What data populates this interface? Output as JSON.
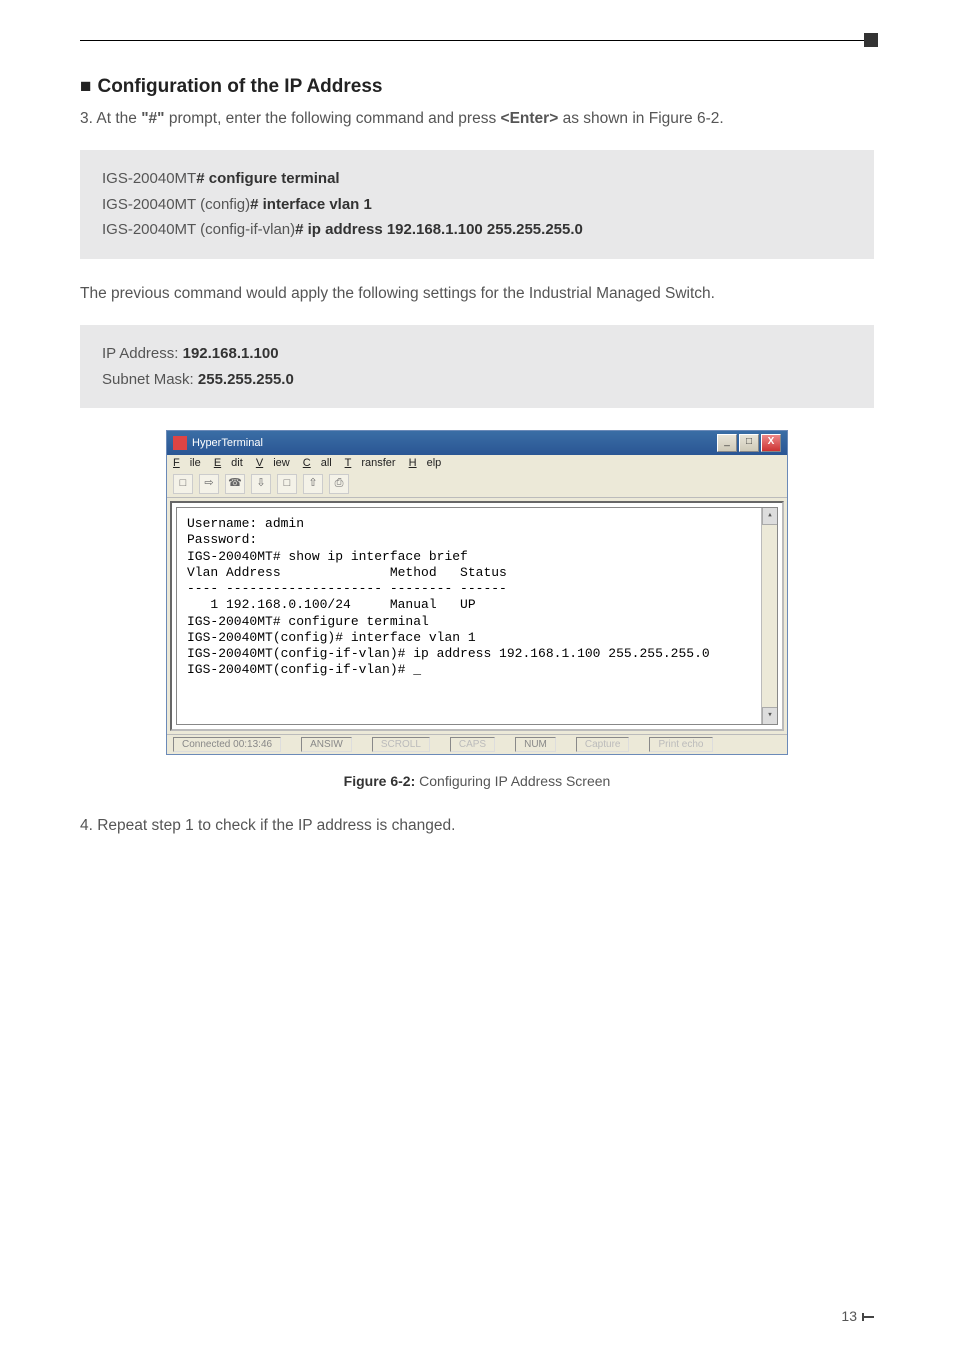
{
  "section": {
    "bullet": "■",
    "title": "Configuration of the IP Address"
  },
  "step3": {
    "prefix": "3. At the ",
    "prompt": "\"#\"",
    "mid": " prompt, enter the following command and press ",
    "key": "<Enter>",
    "suffix": " as shown in Figure 6-2."
  },
  "codebox1": {
    "line1_pre": "IGS-20040MT",
    "line1_bold": "# configure terminal",
    "line2_pre": "IGS-20040MT (config)",
    "line2_bold": "# interface vlan 1",
    "line3_pre": "IGS-20040MT (config-if-vlan)",
    "line3_bold": "# ip address 192.168.1.100 255.255.255.0"
  },
  "para2": "The previous command would apply the following settings for the Industrial Managed Switch.",
  "codebox2": {
    "line1_pre": "IP Address: ",
    "line1_bold": "192.168.1.100",
    "line2_pre": "Subnet Mask: ",
    "line2_bold": "255.255.255.0"
  },
  "hyper": {
    "title": "HyperTerminal",
    "menu": {
      "file": "File",
      "edit": "Edit",
      "view": "View",
      "call": "Call",
      "transfer": "Transfer",
      "help": "Help"
    },
    "toolbar_icons": [
      "□",
      "⇨",
      "☎",
      "⇩",
      "□",
      "⇧",
      "⎙"
    ],
    "terminal_text": "Username: admin\nPassword:\nIGS-20040MT# show ip interface brief\nVlan Address              Method   Status\n---- -------------------- -------- ------\n   1 192.168.0.100/24     Manual   UP\nIGS-20040MT# configure terminal\nIGS-20040MT(config)# interface vlan 1\nIGS-20040MT(config-if-vlan)# ip address 192.168.1.100 255.255.255.0\nIGS-20040MT(config-if-vlan)# _",
    "status": {
      "connected": "Connected 00:13:46",
      "term": "ANSIW",
      "scroll": "SCROLL",
      "caps": "CAPS",
      "num": "NUM",
      "capture": "Capture",
      "printecho": "Print echo"
    },
    "win_btn_min": "_",
    "win_btn_max": "□",
    "win_btn_close": "X",
    "scroll_up": "▴",
    "scroll_down": "▾"
  },
  "figcap": {
    "bold": "Figure 6-2:",
    "rest": "  Configuring IP Address Screen"
  },
  "step4": "4. Repeat step 1 to check if the IP address is changed.",
  "pagenum": "13"
}
